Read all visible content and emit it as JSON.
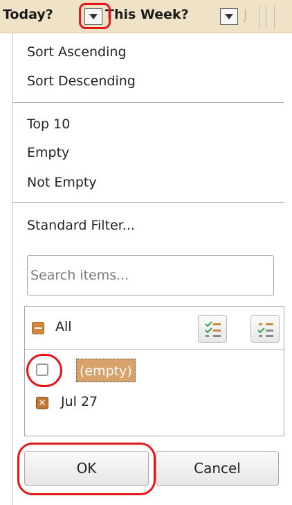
{
  "header": {
    "col1_title": "Today?",
    "col2_title": "This Week?",
    "col3_partial": "J"
  },
  "menu": {
    "sort_ascending": "Sort Ascending",
    "sort_descending": "Sort Descending",
    "top10": "Top 10",
    "empty": "Empty",
    "not_empty": "Not Empty",
    "standard_filter": "Standard Filter..."
  },
  "search": {
    "placeholder": "Search items..."
  },
  "list": {
    "all_label": "All",
    "items": [
      {
        "label": "(empty)",
        "checked": false,
        "selected": true
      },
      {
        "label": "Jul 27",
        "checked": true,
        "selected": false
      }
    ]
  },
  "buttons": {
    "ok": "OK",
    "cancel": "Cancel"
  },
  "colors": {
    "accent": "#d08a3f",
    "highlight": "#e2161b",
    "header_bg": "#efe2c6"
  },
  "icons": [
    "dropdown-arrow-icon",
    "select-all-icon",
    "select-current-icon"
  ]
}
